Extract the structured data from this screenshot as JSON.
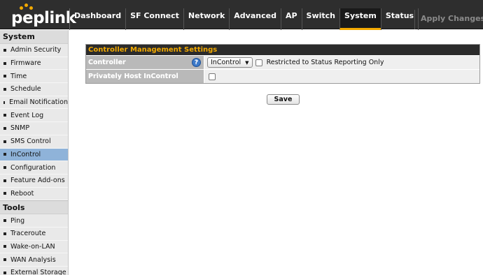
{
  "brand": {
    "name": "peplink",
    "accent": "#f2a900"
  },
  "nav": {
    "items": [
      {
        "label": "Dashboard"
      },
      {
        "label": "SF Connect"
      },
      {
        "label": "Network"
      },
      {
        "label": "Advanced"
      },
      {
        "label": "AP"
      },
      {
        "label": "Switch"
      },
      {
        "label": "System",
        "active": true
      },
      {
        "label": "Status"
      }
    ],
    "apply_label": "Apply Changes"
  },
  "sidebar": {
    "system_heading": "System",
    "system_items": [
      {
        "label": "Admin Security"
      },
      {
        "label": "Firmware"
      },
      {
        "label": "Time"
      },
      {
        "label": "Schedule"
      },
      {
        "label": "Email Notification"
      },
      {
        "label": "Event Log"
      },
      {
        "label": "SNMP"
      },
      {
        "label": "SMS Control"
      },
      {
        "label": "InControl",
        "active": true
      },
      {
        "label": "Configuration"
      },
      {
        "label": "Feature Add-ons"
      },
      {
        "label": "Reboot"
      }
    ],
    "tools_heading": "Tools",
    "tools_items": [
      {
        "label": "Ping"
      },
      {
        "label": "Traceroute"
      },
      {
        "label": "Wake-on-LAN"
      },
      {
        "label": "WAN Analysis"
      },
      {
        "label": "External Storage"
      }
    ]
  },
  "panel": {
    "title": "Controller Management Settings",
    "controller_label": "Controller",
    "controller_value": "InControl",
    "restricted_label": "Restricted to Status Reporting Only",
    "restricted_checked": false,
    "private_label": "Privately Host InControl",
    "private_checked": false,
    "help_icon": "question-mark-icon"
  },
  "save_label": "Save"
}
